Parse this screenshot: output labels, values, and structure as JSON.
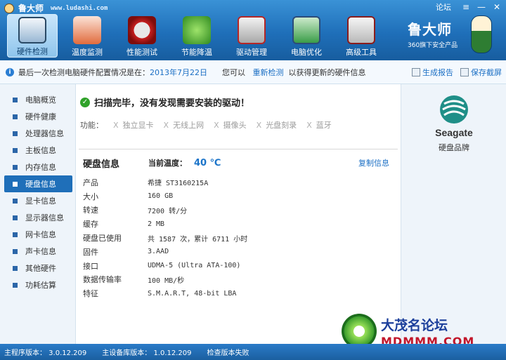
{
  "window": {
    "app_name": "鲁大师",
    "url_text": "www.ludashi.com",
    "forum": "论坛",
    "btn_menu": "≡",
    "btn_min": "—",
    "btn_close": "✕"
  },
  "toolbar": [
    {
      "label": "硬件检测",
      "icon": "monitor-magnifier-icon"
    },
    {
      "label": "温度监测",
      "icon": "thermometer-icon"
    },
    {
      "label": "性能测试",
      "icon": "speed-gauge-icon"
    },
    {
      "label": "节能降温",
      "icon": "clover-icon"
    },
    {
      "label": "驱动管理",
      "icon": "driver-box-icon"
    },
    {
      "label": "电脑优化",
      "icon": "optimize-screen-icon"
    },
    {
      "label": "高级工具",
      "icon": "toolbox-icon"
    }
  ],
  "mascot": {
    "big": "鲁大师",
    "small": "360旗下安全产品"
  },
  "infobar": {
    "prefix": "最后一次检测电脑硬件配置情况是在：",
    "date": "2013年7月22日",
    "middle": "您可以",
    "redetect": "重新检测",
    "suffix": "以获得更新的硬件信息",
    "report": "生成报告",
    "screenshot": "保存截屏"
  },
  "sidebar": {
    "items": [
      {
        "label": "电脑概览"
      },
      {
        "label": "硬件健康"
      },
      {
        "label": "处理器信息"
      },
      {
        "label": "主板信息"
      },
      {
        "label": "内存信息"
      },
      {
        "label": "硬盘信息",
        "active": true
      },
      {
        "label": "显卡信息"
      },
      {
        "label": "显示器信息"
      },
      {
        "label": "网卡信息"
      },
      {
        "label": "声卡信息"
      },
      {
        "label": "其他硬件"
      },
      {
        "label": "功耗估算"
      }
    ]
  },
  "main": {
    "scan_message": "扫描完毕，没有发现需要安装的驱动！",
    "functions_label": "功能：",
    "functions": [
      "独立显卡",
      "无线上网",
      "摄像头",
      "光盘刻录",
      "蓝牙"
    ],
    "x_mark": "X",
    "section_title": "硬盘信息",
    "temp_label": "当前温度：",
    "temp_value": "40 ℃",
    "copy": "复制信息",
    "specs": [
      {
        "k": "产品",
        "v": "希捷 ST3160215A"
      },
      {
        "k": "大小",
        "v": "160 GB"
      },
      {
        "k": "转速",
        "v": "7200 转/分"
      },
      {
        "k": "缓存",
        "v": "2 MB"
      },
      {
        "k": "硬盘已使用",
        "v": "共 1587 次，累计 6711 小时"
      },
      {
        "k": "固件",
        "v": "3.AAD"
      },
      {
        "k": "接口",
        "v": "UDMA-5 (Ultra ATA-100)"
      },
      {
        "k": "数据传输率",
        "v": "100 MB/秒"
      },
      {
        "k": "特征",
        "v": "S.M.A.R.T,  48-bit LBA"
      }
    ]
  },
  "right_panel": {
    "logo_text": "Seagate",
    "brand_label": "硬盘品牌"
  },
  "watermark": {
    "title": "大茂名论坛",
    "url": "MDMMM.COM"
  },
  "status": {
    "main_version": "主程序版本： 3.0.12.209",
    "db_version": "主设备库版本： 1.0.12.209",
    "check": "检查版本失败"
  }
}
